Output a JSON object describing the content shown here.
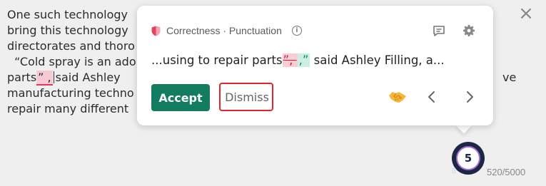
{
  "document": {
    "lines": [
      {
        "before": "One such technology",
        "error": "",
        "after": ""
      },
      {
        "before": "bring this technology",
        "error": "",
        "after": ""
      },
      {
        "before": "directorates and thoro",
        "error": "",
        "after": ""
      },
      {
        "before": "  “Cold spray is an ado",
        "error": "",
        "after": ""
      },
      {
        "before": "parts",
        "error": "” ,",
        "after": "said Ashley",
        "trailing": "ve"
      },
      {
        "before": "manufacturing techno",
        "error": "",
        "after": ""
      },
      {
        "before": "repair many different",
        "error": "",
        "after": ""
      }
    ],
    "close_glyph": "×"
  },
  "card": {
    "category": "Correctness · Punctuation",
    "info_glyph": "i",
    "preview": {
      "before": "...using to repair parts",
      "deleted": "”, ",
      "inserted": ",”",
      "after": " said Ashley Filling, a..."
    },
    "accept_label": "Accept",
    "dismiss_label": "Dismiss",
    "icons": [
      "shield-icon",
      "feedback-icon",
      "settings-icon",
      "handshake-icon",
      "chevron-left-icon",
      "chevron-right-icon"
    ]
  },
  "status": {
    "suggestion_count": "5",
    "char_count": "520/5000"
  },
  "colors": {
    "accept": "#137b5f",
    "error_highlight": "#f7c9d2",
    "dismiss_outline": "#e3242b",
    "gauge": "#1b2744"
  }
}
